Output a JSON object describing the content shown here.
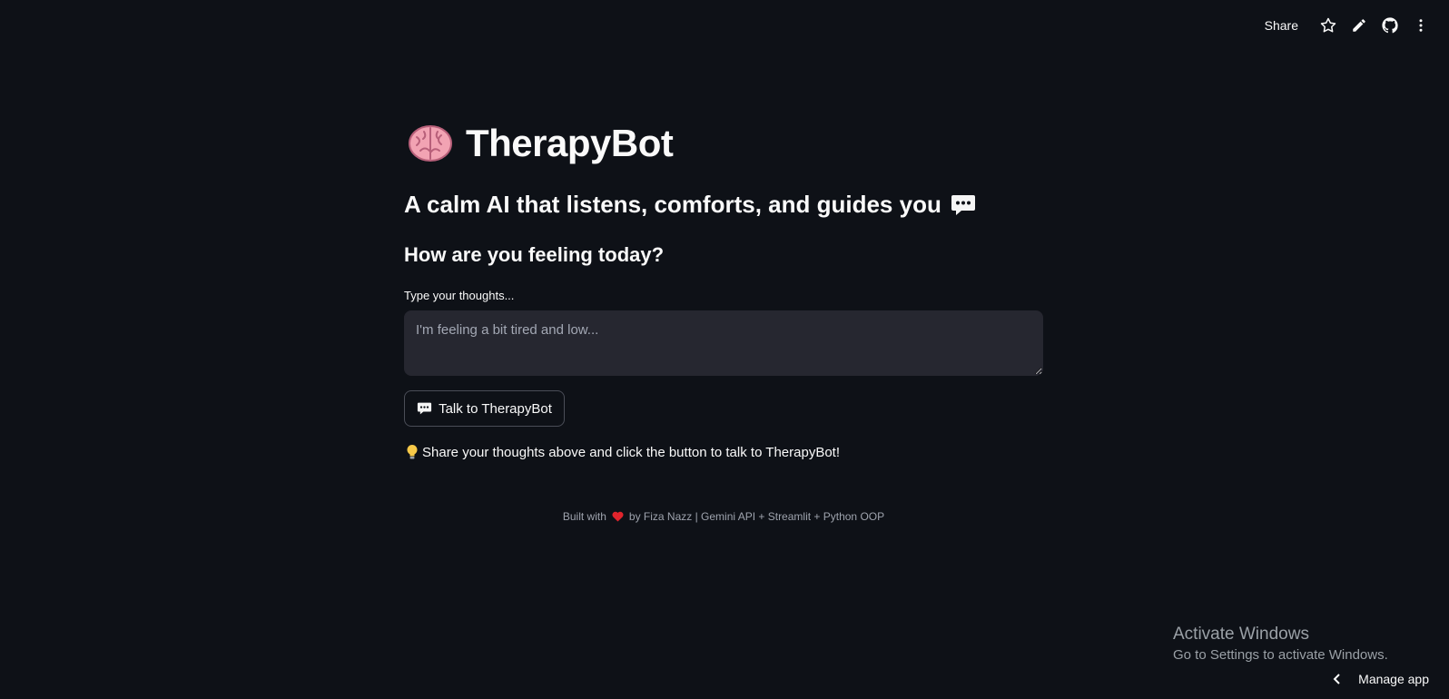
{
  "topbar": {
    "share_label": "Share",
    "icons": [
      "star-icon",
      "pencil-icon",
      "github-icon",
      "more-vertical-icon"
    ]
  },
  "main": {
    "title": "TherapyBot",
    "title_icon": "brain-icon",
    "subtitle": "A calm AI that listens, comforts, and guides you",
    "subtitle_icon": "speech-bubble-icon",
    "heading": "How are you feeling today?",
    "input_label": "Type your thoughts...",
    "input_placeholder": "I'm feeling a bit tired and low...",
    "button_label": "Talk to TherapyBot",
    "hint_text": "Share your thoughts above and click the button to talk to TherapyBot!",
    "hint_icon": "lightbulb-icon"
  },
  "footer": {
    "prefix": "Built with",
    "suffix": "by Fiza Nazz | Gemini API + Streamlit + Python OOP",
    "heart_color": "#e0242c"
  },
  "windows_overlay": {
    "line1": "Activate Windows",
    "line2": "Go to Settings to activate Windows."
  },
  "manage_app_label": "Manage app",
  "colors": {
    "background": "#0e1117",
    "input_bg": "#262730",
    "text": "#fafafa"
  }
}
